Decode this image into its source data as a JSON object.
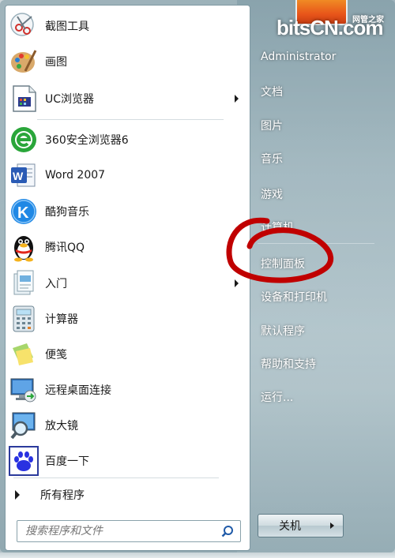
{
  "programs": [
    {
      "label": "截图工具",
      "icon": "scissors-icon",
      "arrow": false
    },
    {
      "label": "画图",
      "icon": "paint-palette-icon",
      "arrow": false
    },
    {
      "label": "UC浏览器",
      "icon": "uc-browser-icon",
      "arrow": true
    },
    {
      "label": "360安全浏览器6",
      "icon": "360-browser-icon",
      "arrow": false
    },
    {
      "label": "Word 2007",
      "icon": "word-icon",
      "arrow": false
    },
    {
      "label": "酷狗音乐",
      "icon": "kugou-icon",
      "arrow": false
    },
    {
      "label": "腾讯QQ",
      "icon": "qq-penguin-icon",
      "arrow": false
    },
    {
      "label": "入门",
      "icon": "getting-started-icon",
      "arrow": true
    },
    {
      "label": "计算器",
      "icon": "calculator-icon",
      "arrow": false
    },
    {
      "label": "便笺",
      "icon": "sticky-notes-icon",
      "arrow": false
    },
    {
      "label": "远程桌面连接",
      "icon": "remote-desktop-icon",
      "arrow": false
    },
    {
      "label": "放大镜",
      "icon": "magnifier-icon",
      "arrow": false
    },
    {
      "label": "百度一下",
      "icon": "baidu-paw-icon",
      "arrow": false
    }
  ],
  "all_programs_label": "所有程序",
  "search": {
    "placeholder": "搜索程序和文件"
  },
  "right_items": [
    {
      "label": "Administrator",
      "name": "user-name"
    },
    {
      "label": "文档",
      "name": "documents"
    },
    {
      "label": "图片",
      "name": "pictures"
    },
    {
      "label": "音乐",
      "name": "music"
    },
    {
      "label": "游戏",
      "name": "games"
    },
    {
      "label": "计算机",
      "name": "computer"
    },
    {
      "label": "控制面板",
      "name": "control-panel"
    },
    {
      "label": "设备和打印机",
      "name": "devices-printers"
    },
    {
      "label": "默认程序",
      "name": "default-programs"
    },
    {
      "label": "帮助和支持",
      "name": "help-support"
    },
    {
      "label": "运行...",
      "name": "run"
    }
  ],
  "shutdown_label": "关机",
  "watermark": {
    "main": "bitsCN.com",
    "sub": "网管之家"
  },
  "colors": {
    "annotation": "#c00000",
    "right_text": "#ffffff"
  }
}
